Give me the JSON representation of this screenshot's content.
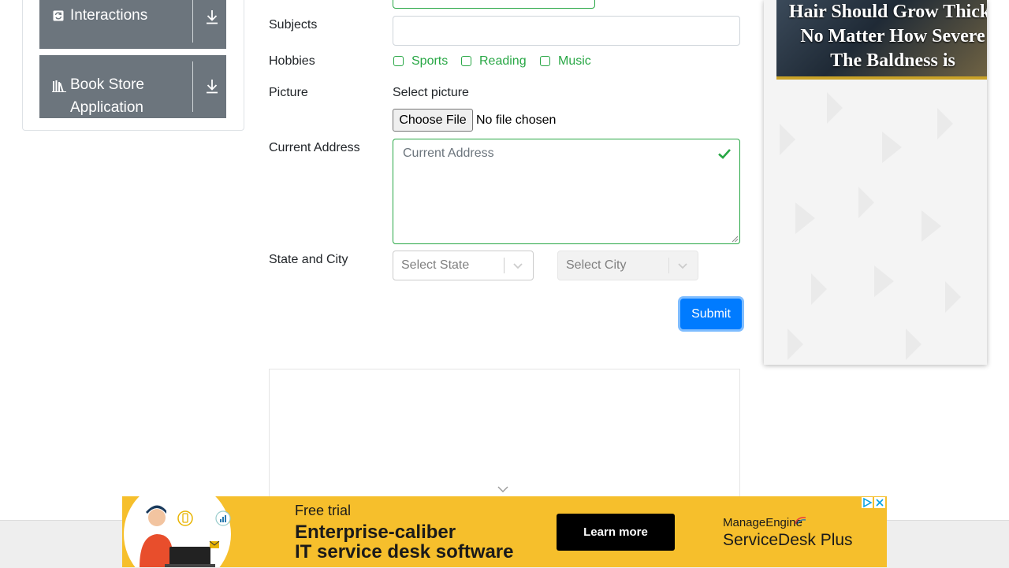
{
  "sidebar": {
    "items": [
      {
        "label": "Interactions"
      },
      {
        "label_line1": "Book Store",
        "label_line2": "Application"
      }
    ]
  },
  "form": {
    "subjects_label": "Subjects",
    "hobbies_label": "Hobbies",
    "hobbies": [
      "Sports",
      "Reading",
      "Music"
    ],
    "picture_label": "Picture",
    "picture_select_label": "Select picture",
    "choose_file_label": "Choose File",
    "no_file_text": "No file chosen",
    "address_label": "Current Address",
    "address_placeholder": "Current Address",
    "state_city_label": "State and City",
    "state_placeholder": "Select State",
    "city_placeholder": "Select City",
    "submit_label": "Submit"
  },
  "ad_right": {
    "text_line1": "Hair Should Grow Thick!",
    "text_line2": "No Matter How Severe",
    "text_line3": "The Baldness is"
  },
  "ad_bottom": {
    "free_trial": "Free trial",
    "headline_line1": "Enterprise-caliber",
    "headline_line2": "IT service desk software",
    "cta": "Learn more",
    "brand_line1": "ManageEngine",
    "brand_line2": "ServiceDesk Plus"
  },
  "colors": {
    "accent": "#28a745",
    "primary": "#007bff",
    "sidebar_item": "#6c757d",
    "ad_yellow": "#f6bf2c"
  }
}
